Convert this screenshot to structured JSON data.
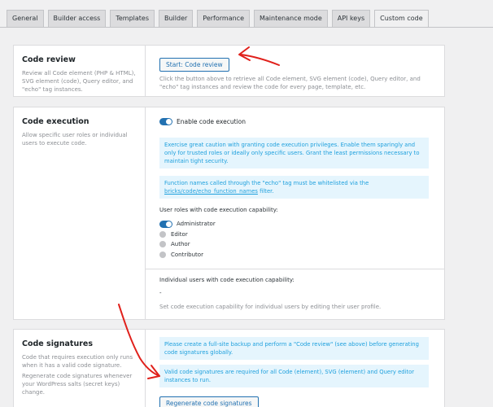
{
  "tabs": [
    {
      "label": "General",
      "active": false
    },
    {
      "label": "Builder access",
      "active": false
    },
    {
      "label": "Templates",
      "active": false
    },
    {
      "label": "Builder",
      "active": false
    },
    {
      "label": "Performance",
      "active": false
    },
    {
      "label": "Maintenance mode",
      "active": false
    },
    {
      "label": "API keys",
      "active": false
    },
    {
      "label": "Custom code",
      "active": true
    }
  ],
  "code_review": {
    "title": "Code review",
    "description": "Review all Code element (PHP & HTML), SVG element (code), Query editor, and \"echo\" tag instances.",
    "button_label": "Start: Code review",
    "help": "Click the button above to retrieve all Code element, SVG element (code), Query editor, and \"echo\" tag instances and review the code for every page, template, etc."
  },
  "code_execution": {
    "title": "Code execution",
    "description": "Allow specific user roles or individual users to execute code.",
    "toggle_label": "Enable code execution",
    "toggle_on": true,
    "notice_caution": "Exercise great caution with granting code execution privileges. Enable them sparingly and only for trusted roles or ideally only specific users. Grant the least permissions necessary to maintain tight security.",
    "notice_functions_prefix": "Function names called through the \"echo\" tag must be whitelisted via the ",
    "notice_functions_link": "bricks/code/echo_function_names",
    "notice_functions_suffix": " filter.",
    "roles_heading": "User roles with code execution capability:",
    "roles": [
      {
        "label": "Administrator",
        "enabled": true
      },
      {
        "label": "Editor",
        "enabled": false
      },
      {
        "label": "Author",
        "enabled": false
      },
      {
        "label": "Contributor",
        "enabled": false
      }
    ],
    "users_heading": "Individual users with code execution capability:",
    "users_value": "-",
    "users_help": "Set code execution capability for individual users by editing their user profile."
  },
  "code_signatures": {
    "title": "Code signatures",
    "description_1": "Code that requires execution only runs when it has a valid code signature.",
    "description_2": "Regenerate code signatures whenever your WordPress salts (secret keys) change.",
    "notice_backup": "Please create a full-site backup and perform a \"Code review\" (see above) before generating code signatures globally.",
    "notice_required": "Valid code signatures are required for all Code (element), SVG (element) and Query editor instances to run.",
    "button_label": "Regenerate code signatures"
  },
  "annotation_color": "#e0201b",
  "accent_color": "#2271b1"
}
